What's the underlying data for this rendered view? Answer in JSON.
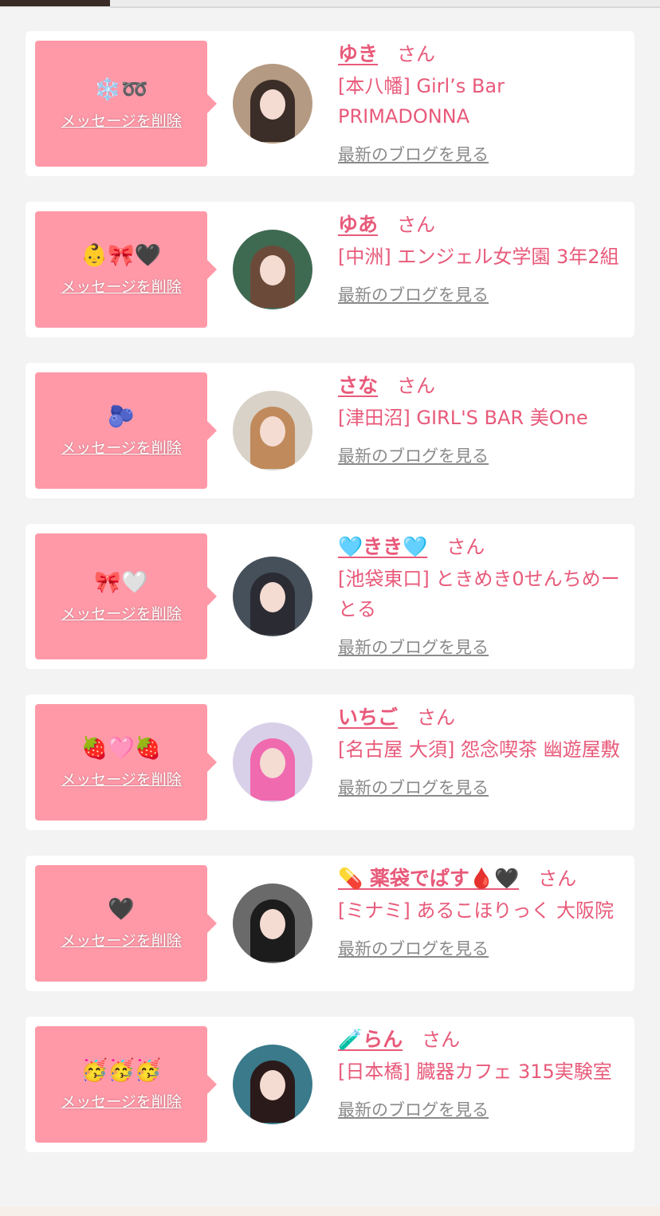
{
  "delete_label": "メッセージを削除",
  "san_label": "さん",
  "blog_label": "最新のブログを見る",
  "colors": {
    "pink_bubble": "#ff99a8",
    "accent_text": "#e85a7a",
    "link_gray": "#8a8a8a"
  },
  "messages": [
    {
      "message": "❄️➿",
      "name": "ゆき",
      "shop": "[本八幡] Girl’s Bar PRIMADONNA",
      "avatar_hair": "#3b2d27",
      "avatar_bg": "#b49a82"
    },
    {
      "message": "👶🎀🖤",
      "name": "ゆあ",
      "shop": "[中洲] エンジェル女学園 3年2組",
      "avatar_hair": "#6b4a3a",
      "avatar_bg": "#3f6a52"
    },
    {
      "message": "🫐",
      "name": "さな",
      "shop": "[津田沼] GIRL'S BAR 美One",
      "avatar_hair": "#c08a5c",
      "avatar_bg": "#d9d2c8"
    },
    {
      "message": "🎀🤍",
      "name": "🩵きき🩵",
      "shop": "[池袋東口] ときめき0せんちめーとる",
      "avatar_hair": "#2b2b33",
      "avatar_bg": "#46505a"
    },
    {
      "message": "🍓🩷🍓",
      "name": "いちご",
      "shop": "[名古屋 大須] 怨念喫茶 幽遊屋敷",
      "avatar_hair": "#f06ab0",
      "avatar_bg": "#d8d0e8"
    },
    {
      "message": "🖤",
      "name": "💊 薬袋でぱす🩸🖤",
      "shop": "[ミナミ] あるこほりっく 大阪院",
      "avatar_hair": "#1c1c1c",
      "avatar_bg": "#6a6a6a"
    },
    {
      "message": "🥳🥳🥳",
      "name": "🧪らん",
      "shop": "[日本橋] 臓器カフェ 315実験室",
      "avatar_hair": "#2a1a1a",
      "avatar_bg": "#3a7a8a"
    }
  ]
}
